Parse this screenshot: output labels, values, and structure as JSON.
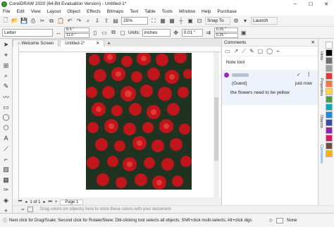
{
  "window": {
    "title": "CorelDRAW 2020 (64-Bit Evaluation Version) - Untitled-1*"
  },
  "menu": [
    "File",
    "Edit",
    "View",
    "Layout",
    "Object",
    "Effects",
    "Bitmaps",
    "Text",
    "Table",
    "Tools",
    "Window",
    "Help",
    "Purchase"
  ],
  "toolbar": {
    "zoom": "25%",
    "snap": "Snap To",
    "launch": "Launch"
  },
  "propbar": {
    "page_size": "Letter",
    "width": "8.5 \"",
    "height": "11.0 \"",
    "units_label": "Units:",
    "units": "inches",
    "nudge": "0.01 \"",
    "dup_x": "0.25 \"",
    "dup_y": "0.25 \""
  },
  "tabs": [
    {
      "label": "Welcome Screen"
    },
    {
      "label": "Untitled-1*"
    }
  ],
  "pages": {
    "label": "Page 1"
  },
  "palette_hint": "Drag colors (or objects) here to store these colors with your document",
  "docker": {
    "title": "Comments",
    "tool_label": "Note tool",
    "comment": {
      "author": "(Guest)",
      "time": "just now",
      "text": "the flowers need to be yellow"
    }
  },
  "side_tabs": [
    "Hints",
    "Properties",
    "Objects",
    "Comments"
  ],
  "status": {
    "hint": "Next click for Drag/Scale; Second click for Rotate/Skew; Dbl-clicking tool selects all objects; Shift+click multi-selects; Alt+click digs",
    "fill": "None"
  },
  "colors": {
    "accent": "#1e88e5",
    "palette": [
      "#ffffff",
      "#000000",
      "#e53935",
      "#ff7043",
      "#fdd835",
      "#43a047",
      "#00acc1",
      "#1e88e5",
      "#3949ab",
      "#8e24aa",
      "#d81b60",
      "#6d4c41",
      "#9e9e9e",
      "#ffb300"
    ]
  }
}
